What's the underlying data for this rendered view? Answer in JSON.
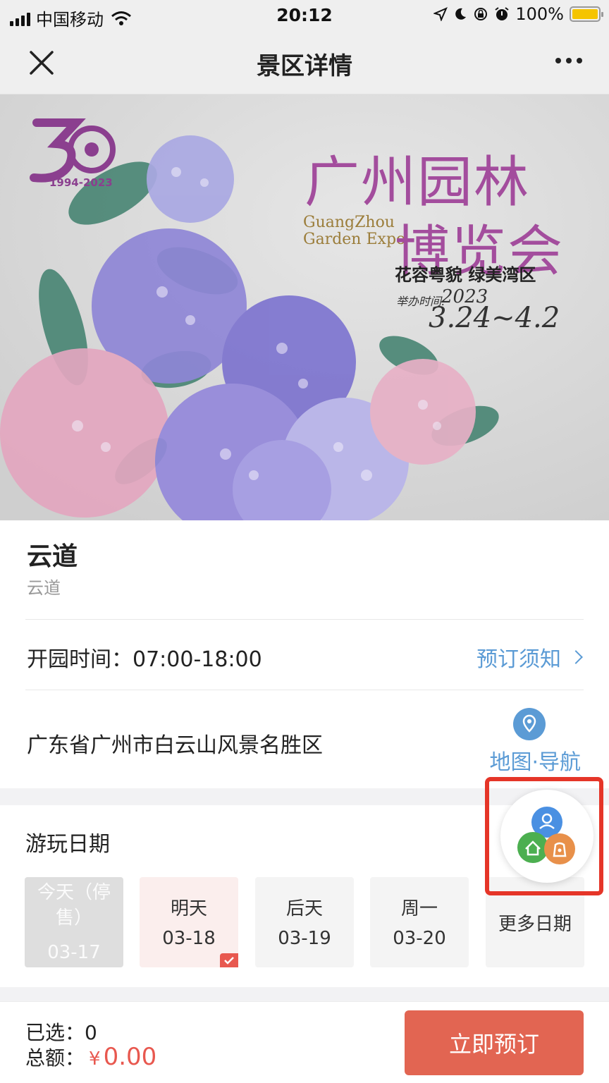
{
  "status_bar": {
    "carrier": "中国移动",
    "time": "20:12",
    "battery": "100%"
  },
  "nav": {
    "title": "景区详情"
  },
  "banner": {
    "anniversary_years": "1994-2023",
    "title_line1": "广州园林",
    "title_line2": "博览会",
    "title_en_line1": "GuangZhou",
    "title_en_line2": "Garden Expo",
    "slogan": "花容粤貌  绿美湾区",
    "date_label": "举办时间:",
    "year": "2023",
    "date_range": "3.24~4.2"
  },
  "scenic": {
    "name": "云道",
    "subname": "云道",
    "hours_label": "开园时间：",
    "hours_value": "07:00-18:00",
    "notice_link": "预订须知",
    "address": "广东省广州市白云山风景名胜区",
    "map_link": "地图·导航"
  },
  "play_date": {
    "title": "游玩日期",
    "dates": [
      {
        "label": "今天（停售）",
        "date": "03-17",
        "state": "disabled"
      },
      {
        "label": "明天",
        "date": "03-18",
        "state": "selected"
      },
      {
        "label": "后天",
        "date": "03-19",
        "state": "normal"
      },
      {
        "label": "周一",
        "date": "03-20",
        "state": "normal"
      }
    ],
    "more_label": "更多日期"
  },
  "footer": {
    "selected_label": "已选：",
    "selected_count": "0",
    "total_label": "总额：",
    "currency": "¥",
    "total_amount": "0.00",
    "book_button": "立即预订"
  },
  "colors": {
    "accent_blue": "#5b9bd5",
    "accent_red": "#e26552",
    "highlight_red": "#e53528",
    "float_icon_blue": "#4a90e2",
    "float_icon_green": "#4caf50",
    "float_icon_orange": "#e8904a"
  }
}
